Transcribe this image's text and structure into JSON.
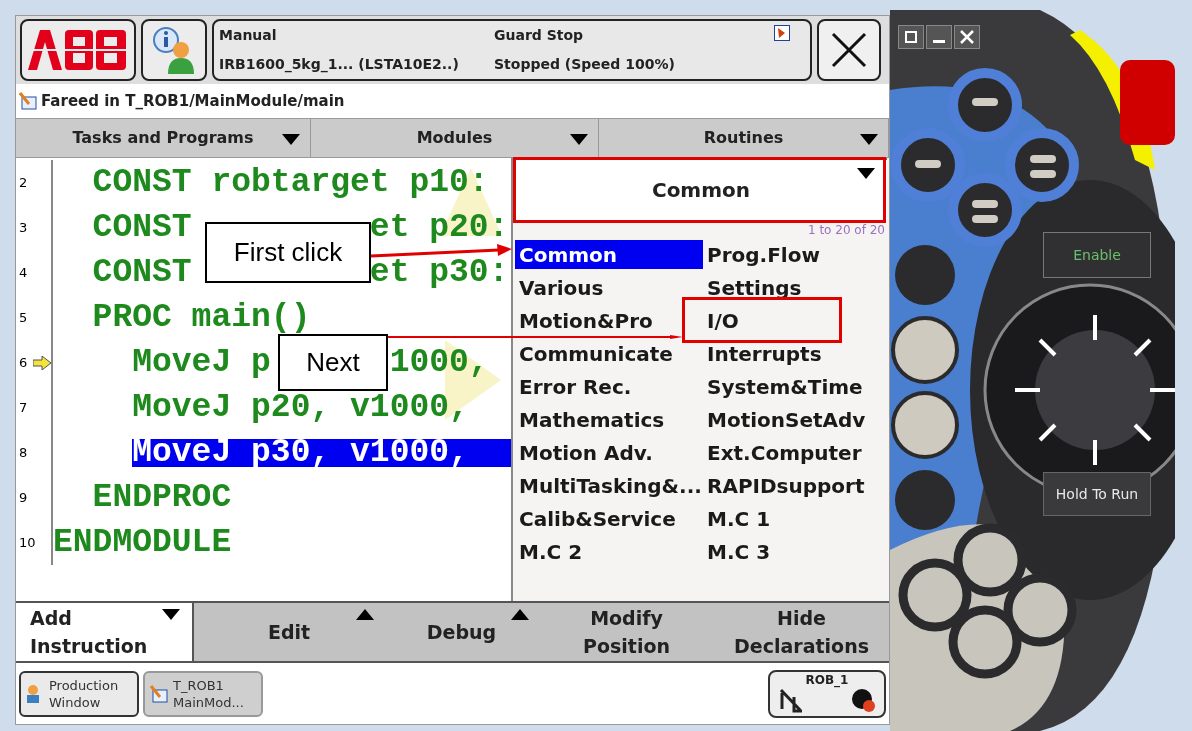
{
  "header": {
    "status": {
      "mode": "Manual",
      "system": "IRB1600_5kg_1... (LSTA10E2..)",
      "state": "Guard Stop",
      "run": "Stopped (Speed 100%)"
    }
  },
  "path": "Fareed in T_ROB1/MainModule/main",
  "tabs": [
    {
      "label": "Tasks and Programs"
    },
    {
      "label": "Modules"
    },
    {
      "label": "Routines"
    }
  ],
  "code_lines": [
    {
      "number": "2",
      "parts": [
        "  CONST robtarget p10:"
      ],
      "selected": false,
      "program_pointer": false
    },
    {
      "number": "3",
      "parts": [
        "  CONST",
        "et p20:"
      ],
      "selected": false,
      "program_pointer": false
    },
    {
      "number": "4",
      "parts": [
        "  CONST",
        "et p30:"
      ],
      "selected": false,
      "program_pointer": false
    },
    {
      "number": "5",
      "parts": [
        "  PROC main()"
      ],
      "selected": false,
      "program_pointer": false
    },
    {
      "number": "6",
      "parts": [
        "    MoveJ p",
        "1000,"
      ],
      "selected": false,
      "program_pointer": true
    },
    {
      "number": "7",
      "parts": [
        "    MoveJ p20, v1000,"
      ],
      "selected": false,
      "program_pointer": false
    },
    {
      "number": "8",
      "parts": [
        "    MoveJ p30, v1000,"
      ],
      "selected": true,
      "program_pointer": false
    },
    {
      "number": "9",
      "parts": [
        "  ENDPROC"
      ],
      "selected": false,
      "program_pointer": false
    },
    {
      "number": "10",
      "parts": [
        "ENDMODULE"
      ],
      "selected": false,
      "program_pointer": false
    }
  ],
  "category_picker": {
    "value": "Common",
    "count": "1 to 20 of 20",
    "items": [
      {
        "label": "Common",
        "selected": true
      },
      {
        "label": "Prog.Flow",
        "selected": false
      },
      {
        "label": "Various",
        "selected": false
      },
      {
        "label": "Settings",
        "selected": false
      },
      {
        "label": "Motion&Pro",
        "selected": false
      },
      {
        "label": "I/O",
        "selected": false
      },
      {
        "label": "Communicate",
        "selected": false
      },
      {
        "label": "Interrupts",
        "selected": false
      },
      {
        "label": "Error Rec.",
        "selected": false
      },
      {
        "label": "System&Time",
        "selected": false
      },
      {
        "label": "Mathematics",
        "selected": false
      },
      {
        "label": "MotionSetAdv",
        "selected": false
      },
      {
        "label": "Motion Adv.",
        "selected": false
      },
      {
        "label": "Ext.Computer",
        "selected": false
      },
      {
        "label": "MultiTasking&...",
        "selected": false
      },
      {
        "label": "RAPIDsupport",
        "selected": false
      },
      {
        "label": "Calib&Service",
        "selected": false
      },
      {
        "label": "M.C 1",
        "selected": false
      },
      {
        "label": "M.C 2",
        "selected": false
      },
      {
        "label": "M.C 3",
        "selected": false
      }
    ]
  },
  "commands": [
    {
      "lines": [
        "Add",
        "Instruction"
      ],
      "selected": true,
      "drop_down": true,
      "pop_up": false
    },
    {
      "lines": [
        "Edit"
      ],
      "selected": false,
      "drop_down": false,
      "pop_up": true
    },
    {
      "lines": [
        "Debug"
      ],
      "selected": false,
      "drop_down": false,
      "pop_up": true
    },
    {
      "lines": [
        "Modify",
        "Position"
      ],
      "selected": false,
      "drop_down": false,
      "pop_up": false
    },
    {
      "lines": [
        "Hide",
        "Declarations"
      ],
      "selected": false,
      "drop_down": false,
      "pop_up": false
    }
  ],
  "taskbar": [
    {
      "lines": [
        "Production",
        "Window"
      ],
      "selected": false
    },
    {
      "lines": [
        "T_ROB1",
        "MainMod..."
      ],
      "selected": true
    }
  ],
  "quickset": {
    "label": "ROB_1"
  },
  "callouts": [
    {
      "text": "First click"
    },
    {
      "text": "Next"
    }
  ],
  "pendant": {
    "enable": "Enable",
    "hold": "Hold To Run"
  }
}
